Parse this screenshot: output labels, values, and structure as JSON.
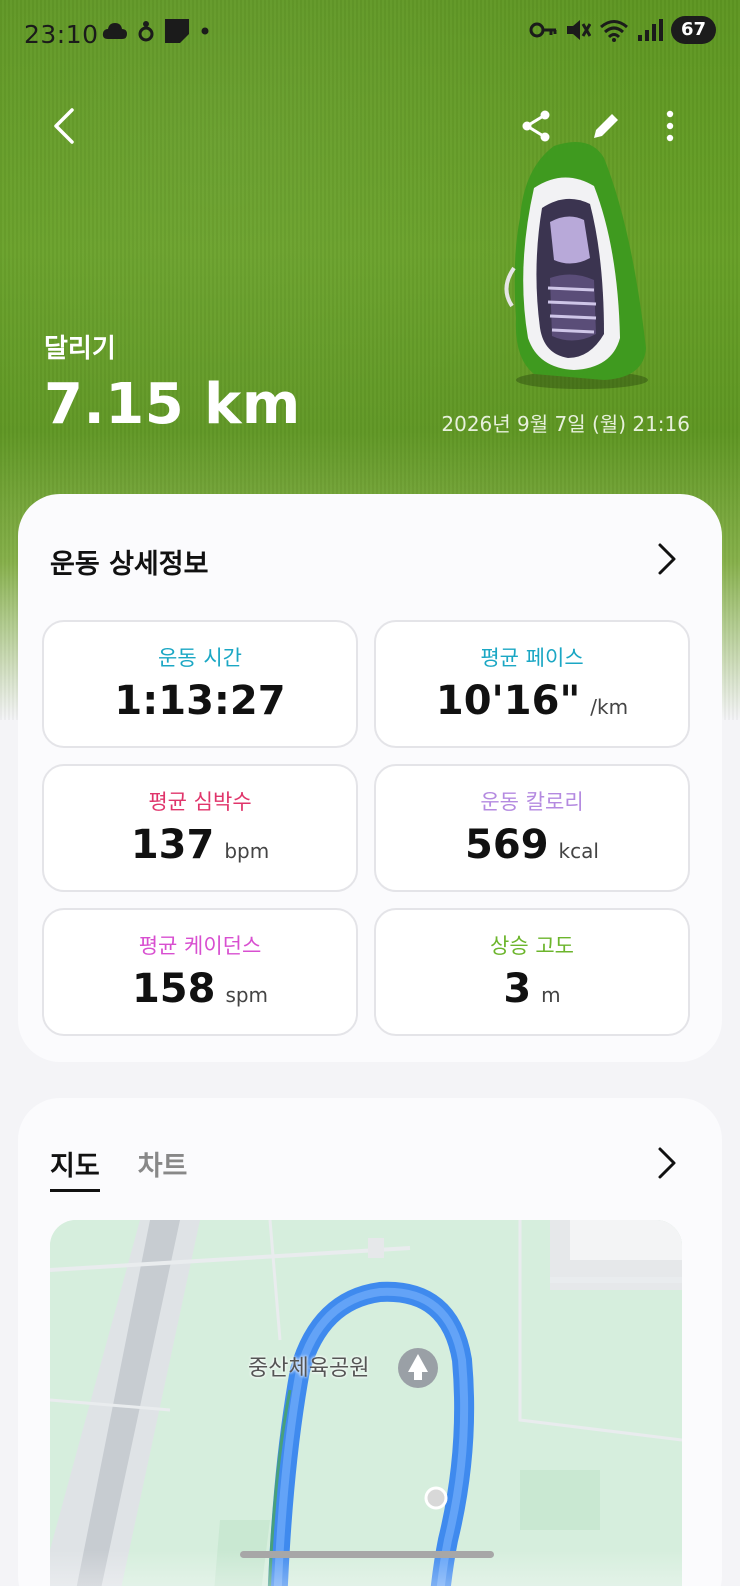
{
  "status_bar": {
    "time": "23:10",
    "battery": "67",
    "left_icons": [
      "cloud-icon",
      "notification-icon",
      "sticky-note-icon",
      "dot-icon"
    ],
    "right_icons": [
      "key-icon",
      "mute-icon",
      "wifi-icon",
      "signal-icon"
    ]
  },
  "header": {
    "back_icon": "chevron-left-icon",
    "share_icon": "share-icon",
    "edit_icon": "pencil-icon",
    "more_icon": "more-vertical-icon"
  },
  "activity": {
    "name": "달리기",
    "distance": "7.15 km",
    "datetime": "2026년 9월 7일 (월) 21:16"
  },
  "details": {
    "title": "운동 상세정보",
    "metrics": [
      {
        "label": "운동 시간",
        "value": "1:13:27",
        "unit": "",
        "color": "#1ba7c4"
      },
      {
        "label": "평균 페이스",
        "value": "10'16\"",
        "unit": "/km",
        "color": "#1ba7c4"
      },
      {
        "label": "평균 심박수",
        "value": "137",
        "unit": "bpm",
        "color": "#e0356b"
      },
      {
        "label": "운동 칼로리",
        "value": "569",
        "unit": "kcal",
        "color": "#b48ae0"
      },
      {
        "label": "평균 케이던스",
        "value": "158",
        "unit": "spm",
        "color": "#d84fd0"
      },
      {
        "label": "상승 고도",
        "value": "3",
        "unit": "m",
        "color": "#6cb52c"
      }
    ]
  },
  "map_section": {
    "tabs": [
      "지도",
      "차트"
    ],
    "active_tab": "지도",
    "place_label": "중산체육공원",
    "route_color": "#2f7ef0"
  }
}
